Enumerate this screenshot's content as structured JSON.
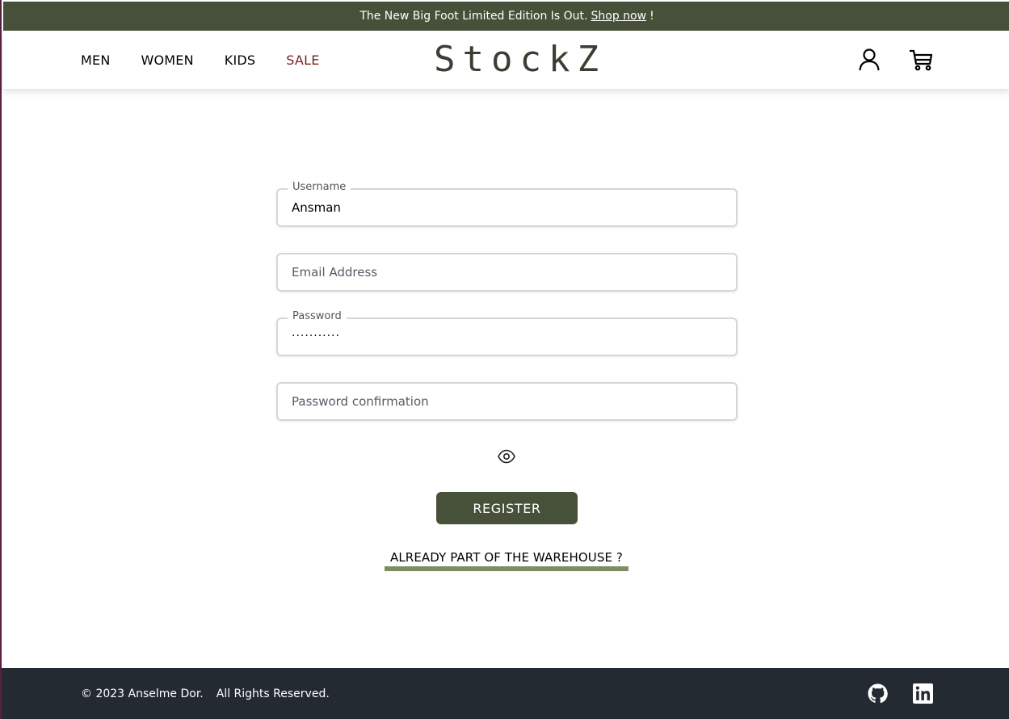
{
  "announcement": {
    "text": "The New Big Foot Limited Edition Is Out.",
    "link": "Shop now",
    "suffix": "!"
  },
  "nav": {
    "items": [
      "MEN",
      "WOMEN",
      "KIDS",
      "SALE"
    ]
  },
  "brand": {
    "logo": "StockZ"
  },
  "form": {
    "username": {
      "legend": "Username",
      "value": "Ansman"
    },
    "email": {
      "placeholder": "Email Address"
    },
    "password": {
      "legend": "Password",
      "value": "..........."
    },
    "password_confirmation": {
      "placeholder": "Password confirmation"
    },
    "register_label": "REGISTER",
    "login_link": "ALREADY PART OF THE WAREHOUSE ?"
  },
  "footer": {
    "copyright": "© 2023 Anselme Dor.",
    "rights": "All Rights Reserved."
  },
  "icons": {
    "user": "user-icon",
    "cart": "cart-icon",
    "eye": "eye-icon",
    "github": "github-icon",
    "linkedin": "linkedin-icon"
  },
  "colors": {
    "primary": "#475139",
    "sale": "#7a1f22",
    "underline": "#7e8c63",
    "footer": "#232a31"
  }
}
